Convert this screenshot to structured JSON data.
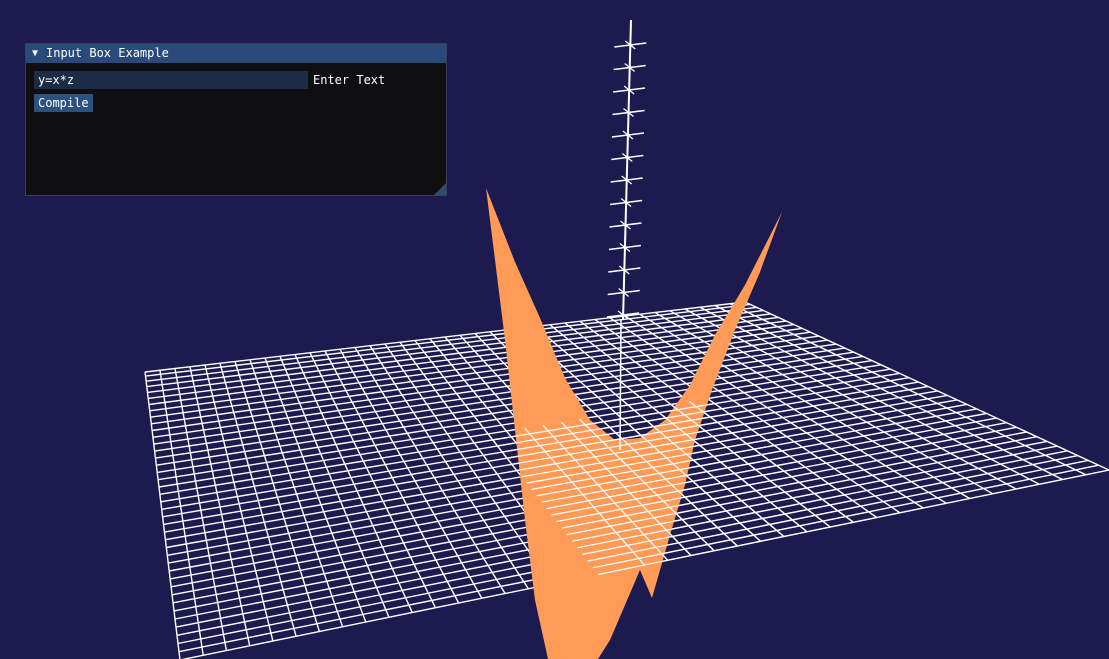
{
  "window": {
    "title": "Input Box Example",
    "collapse_icon": "triangle-down-icon",
    "input": {
      "value": "y=x*z",
      "label": "Enter Text"
    },
    "compile_label": "Compile"
  },
  "scene": {
    "background_color": "#1c1a4f",
    "grid_color": "#ffffff",
    "surface_color": "#ff9b57",
    "surface_equation": "y=x*z"
  }
}
